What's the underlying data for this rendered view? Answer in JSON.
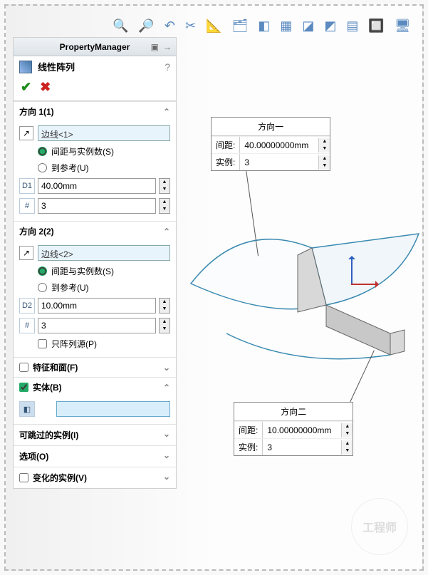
{
  "header": {
    "title": "PropertyManager"
  },
  "feature": {
    "title": "线性阵列"
  },
  "dir1": {
    "title": "方向 1(1)",
    "edge": "边线<1>",
    "opt_spacing": "间距与实例数(S)",
    "opt_ref": "到参考(U)",
    "spacing": "40.00mm",
    "count": "3"
  },
  "dir2": {
    "title": "方向 2(2)",
    "edge": "边线<2>",
    "opt_spacing": "间距与实例数(S)",
    "opt_ref": "到参考(U)",
    "spacing": "10.00mm",
    "count": "3",
    "seed_only": "只阵列源(P)"
  },
  "sections": {
    "features": "特征和面(F)",
    "bodies": "实体(B)",
    "skip": "可跳过的实例(I)",
    "options": "选项(O)",
    "varied": "变化的实例(V)"
  },
  "callout1": {
    "title": "方向一",
    "spacing_lbl": "间距:",
    "spacing": "40.00000000mm",
    "count_lbl": "实例:",
    "count": "3"
  },
  "callout2": {
    "title": "方向二",
    "spacing_lbl": "间距:",
    "spacing": "10.00000000mm",
    "count_lbl": "实例:",
    "count": "3"
  },
  "watermark": "工程师"
}
